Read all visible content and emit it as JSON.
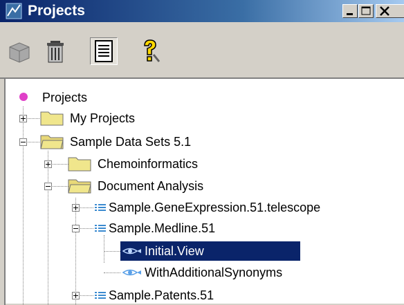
{
  "window": {
    "title": "Projects",
    "controls": [
      "minimize",
      "maximize",
      "close"
    ]
  },
  "toolbar": {
    "buttons": [
      {
        "name": "package-icon",
        "pressed": false
      },
      {
        "name": "trash-icon",
        "pressed": false
      },
      {
        "name": "document-icon",
        "pressed": true
      },
      {
        "name": "help-icon",
        "pressed": false
      }
    ]
  },
  "tree": {
    "root": "Projects",
    "my_projects": "My Projects",
    "sample_data_sets": "Sample Data Sets 5.1",
    "chemoinformatics": "Chemoinformatics",
    "document_analysis": "Document Analysis",
    "gene_expression": "Sample.GeneExpression.51.telescope",
    "medline": "Sample.Medline.51",
    "initial_view": "Initial.View",
    "with_synonyms": "WithAdditionalSynonyms",
    "patents": "Sample.Patents.51"
  },
  "colors": {
    "titlebar_start": "#0a246a",
    "selection": "#0a246a",
    "root_dot": "#e040c8",
    "folder": "#f0e68c"
  }
}
